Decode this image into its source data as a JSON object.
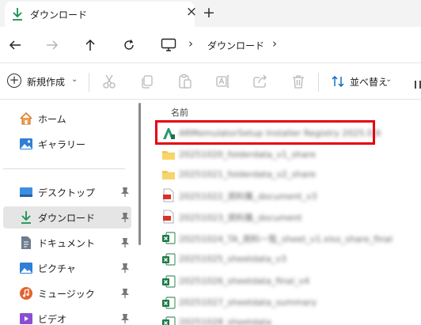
{
  "tab": {
    "title": "ダウンロード",
    "close": "×",
    "new_tab": "+"
  },
  "address": {
    "separator": "›",
    "current": "ダウンロード"
  },
  "command_bar": {
    "new_label": "新規作成",
    "sort_label": "並べ替え",
    "caret": "⌄",
    "icons": [
      "cut-icon",
      "copy-icon",
      "paste-icon",
      "rename-icon",
      "share-icon",
      "delete-icon"
    ]
  },
  "sidebar": {
    "items": [
      {
        "label": "ホーム",
        "icon": "home-icon"
      },
      {
        "label": "ギャラリー",
        "icon": "gallery-icon"
      },
      {
        "label": "デスクトップ",
        "icon": "desktop-icon",
        "pinned": true
      },
      {
        "label": "ダウンロード",
        "icon": "download-icon",
        "pinned": true,
        "selected": true
      },
      {
        "label": "ドキュメント",
        "icon": "documents-icon",
        "pinned": true
      },
      {
        "label": "ピクチャ",
        "icon": "pictures-icon",
        "pinned": true
      },
      {
        "label": "ミュージック",
        "icon": "music-icon",
        "pinned": true
      },
      {
        "label": "ビデオ",
        "icon": "videos-icon",
        "pinned": true
      }
    ]
  },
  "file_list": {
    "column_name": "名前",
    "files": [
      {
        "name": "ARMemulatorSetup Installer Registry 2025.0.6",
        "type": "installer",
        "highlighted": true
      },
      {
        "name": "20251020_folderdata_v1_share",
        "type": "folder"
      },
      {
        "name": "20251021_folderdata_v2_share",
        "type": "folder"
      },
      {
        "name": "20251022_資料集_document_v3",
        "type": "pdf"
      },
      {
        "name": "20251023_資料集_document",
        "type": "pdf"
      },
      {
        "name": "20251024_TA_資料一覧_sheet_v1.xlsx_share_final",
        "type": "excel"
      },
      {
        "name": "20251025_sheetdata_v3",
        "type": "excel"
      },
      {
        "name": "20251026_sheetdata_final_v4",
        "type": "excel"
      },
      {
        "name": "20251027_sheetdata_summary",
        "type": "excel"
      },
      {
        "name": "20251028_sheetdata",
        "type": "excel"
      }
    ]
  },
  "colors": {
    "highlight": "#e60012",
    "accent": "#0067c0",
    "folder": "#f5c84b",
    "pdf": "#d9312b",
    "excel": "#1d7a45",
    "installer": "#2a9a6b"
  }
}
